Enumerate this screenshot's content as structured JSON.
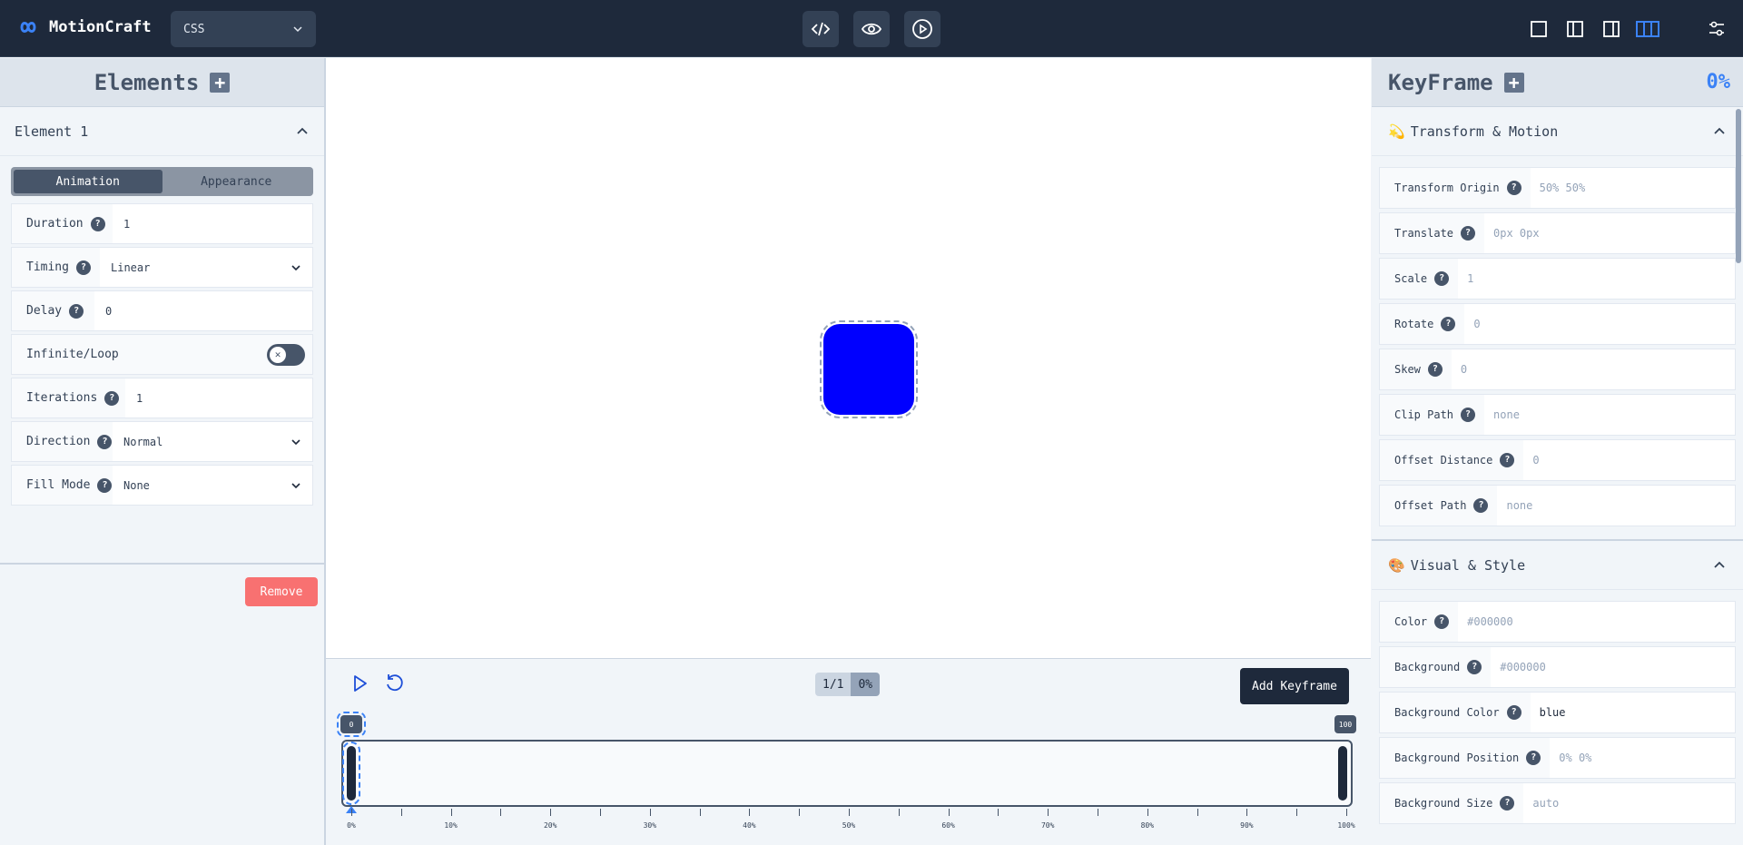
{
  "app": {
    "name": "MotionCraft",
    "language": "CSS"
  },
  "left_panel": {
    "title": "Elements",
    "element": {
      "name": "Element 1",
      "tabs": [
        "Animation",
        "Appearance"
      ],
      "fields": {
        "duration": {
          "label": "Duration",
          "value": "1"
        },
        "timing": {
          "label": "Timing",
          "value": "Linear"
        },
        "delay": {
          "label": "Delay",
          "value": "0"
        },
        "infinite": {
          "label": "Infinite/Loop"
        },
        "iterations": {
          "label": "Iterations",
          "value": "1"
        },
        "direction": {
          "label": "Direction",
          "value": "Normal"
        },
        "fill_mode": {
          "label": "Fill Mode",
          "value": "None"
        }
      },
      "remove_label": "Remove"
    }
  },
  "timeline": {
    "counter": "1/1",
    "percent": "0%",
    "add_keyframe_label": "Add Keyframe",
    "pin_start": "0",
    "pin_end": "100",
    "tick_labels": [
      "0%",
      "10%",
      "20%",
      "30%",
      "40%",
      "50%",
      "60%",
      "70%",
      "80%",
      "90%",
      "100%"
    ]
  },
  "right_panel": {
    "title": "KeyFrame",
    "percent": "0%",
    "transform": {
      "emoji": "💫",
      "title": "Transform & Motion",
      "props": [
        {
          "label": "Transform Origin",
          "value": "50% 50%"
        },
        {
          "label": "Translate",
          "value": "0px 0px"
        },
        {
          "label": "Scale",
          "value": "1"
        },
        {
          "label": "Rotate",
          "value": "0"
        },
        {
          "label": "Skew",
          "value": "0"
        },
        {
          "label": "Clip Path",
          "value": "none"
        },
        {
          "label": "Offset Distance",
          "value": "0"
        },
        {
          "label": "Offset Path",
          "value": "none"
        }
      ]
    },
    "visual": {
      "emoji": "🎨",
      "title": "Visual & Style",
      "props": [
        {
          "label": "Color",
          "value": "#000000"
        },
        {
          "label": "Background",
          "value": "#000000"
        },
        {
          "label": "Background Color",
          "value": "blue"
        },
        {
          "label": "Background Position",
          "value": "0% 0%"
        },
        {
          "label": "Background Size",
          "value": "auto"
        }
      ]
    }
  },
  "colors": {
    "element_fill": "#0000ff",
    "accent": "#3b82f6",
    "danger": "#f87171"
  }
}
